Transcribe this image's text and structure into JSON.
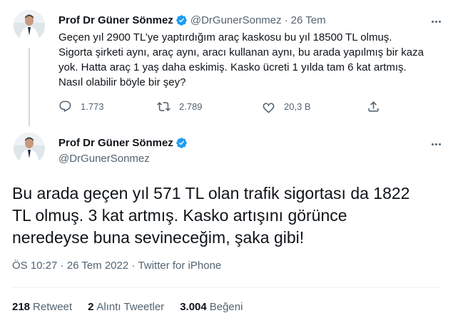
{
  "reply_tweet": {
    "author_name": "Prof Dr Güner Sönmez",
    "author_handle": "@DrGunerSonmez",
    "separator": "·",
    "date": "26 Tem",
    "text_lines": [
      "Geçen yıl 2900 TL’ye yaptırdığım araç kaskosu bu yıl 18500 TL olmuş.",
      "Sigorta şirketi aynı, araç aynı, aracı kullanan aynı, bu arada yapılmış bir kaza",
      "yok. Hatta araç 1 yaş daha eskimiş. Kasko ücreti 1 yılda tam 6 kat artmış.",
      "Nasıl olabilir böyle bir şey?"
    ],
    "replies": "1.773",
    "retweets": "2.789",
    "likes": "20,3 B",
    "icons": [
      "reply-icon",
      "retweet-icon",
      "like-icon",
      "share-icon",
      "more-icon",
      "verified-badge-icon"
    ]
  },
  "main_tweet": {
    "author_name": "Prof Dr Güner Sönmez",
    "author_handle": "@DrGunerSonmez",
    "text_lines": [
      "Bu arada geçen yıl 571 TL olan trafik sigortası da 1822",
      "TL olmuş. 3 kat artmış. Kasko artışını görünce",
      "neredeyse buna sevineceğim, şaka gibi!"
    ],
    "time": "ÖS 10:27",
    "date": "26 Tem 2022",
    "separator": " · ",
    "source": "Twitter for iPhone",
    "stats": {
      "retweets_count": "218",
      "retweets_label": "Retweet",
      "quotes_count": "2",
      "quotes_label": "Alıntı Tweetler",
      "likes_count": "3.004",
      "likes_label": "Beğeni"
    }
  },
  "colors": {
    "text": "#0f1419",
    "secondary": "#536471",
    "verified": "#1d9bf0",
    "divider": "#eff3f4",
    "thread_line": "#cfd9de"
  }
}
